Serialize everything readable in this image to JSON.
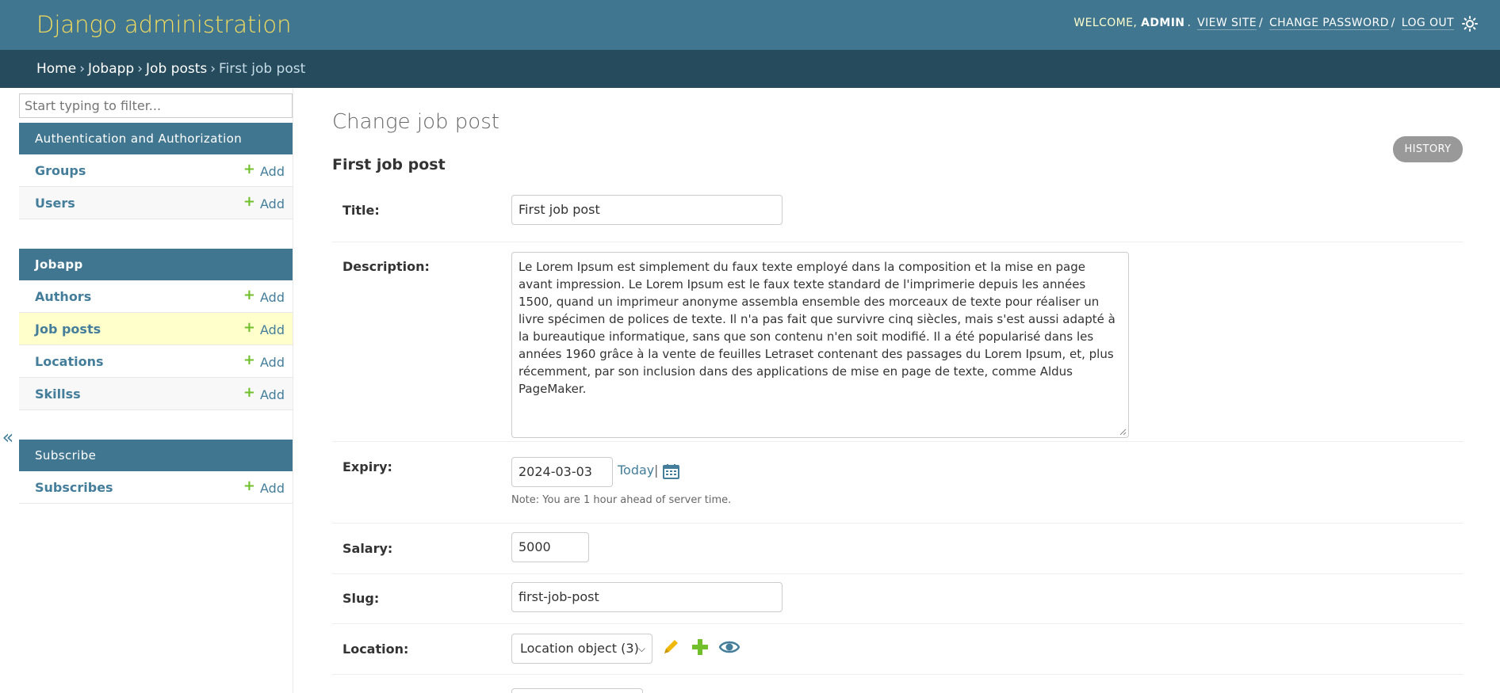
{
  "header": {
    "branding": "Django administration",
    "welcome": "Welcome,",
    "username": "admin",
    "view_site": "View site",
    "change_password": "Change password",
    "log_out": "Log out",
    "theme_icon": "sun-icon"
  },
  "breadcrumbs": {
    "home": "Home",
    "app": "Jobapp",
    "model": "Job posts",
    "current": "First job post"
  },
  "sidebar": {
    "filter_placeholder": "Start typing to filter...",
    "add_label": "Add",
    "apps": [
      {
        "caption": "Authentication and Authorization",
        "models": [
          "Groups",
          "Users"
        ]
      },
      {
        "caption": "Jobapp",
        "models": [
          "Authors",
          "Job posts",
          "Locations",
          "Skillss"
        ]
      },
      {
        "caption": "Subscribe",
        "models": [
          "Subscribes"
        ]
      }
    ],
    "collapse_icon": "«"
  },
  "content": {
    "title": "Change job post",
    "subtitle": "First job post",
    "history_button": "History"
  },
  "form": {
    "title_label": "Title:",
    "title_value": "First job post",
    "description_label": "Description:",
    "description_value": "Le Lorem Ipsum est simplement du faux texte employé dans la composition et la mise en page avant impression. Le Lorem Ipsum est le faux texte standard de l'imprimerie depuis les années 1500, quand un imprimeur anonyme assembla ensemble des morceaux de texte pour réaliser un livre spécimen de polices de texte. Il n'a pas fait que survivre cinq siècles, mais s'est aussi adapté à la bureautique informatique, sans que son contenu n'en soit modifié. Il a été popularisé dans les années 1960 grâce à la vente de feuilles Letraset contenant des passages du Lorem Ipsum, et, plus récemment, par son inclusion dans des applications de mise en page de texte, comme Aldus PageMaker.",
    "expiry_label": "Expiry:",
    "expiry_value": "2024-03-03",
    "today_link": "Today",
    "calendar_sep": "|",
    "expiry_note": "Note: You are 1 hour ahead of server time.",
    "salary_label": "Salary:",
    "salary_value": "5000",
    "slug_label": "Slug:",
    "slug_value": "first-job-post",
    "location_label": "Location:",
    "location_value": "Location object (3)"
  },
  "colors": {
    "header_bg": "#417690",
    "breadcrumb_bg": "#264b5d",
    "branding": "#f5dd5d",
    "link": "#447e9b",
    "add_plus": "#70bf2b",
    "current_row": "#ffffcc"
  }
}
